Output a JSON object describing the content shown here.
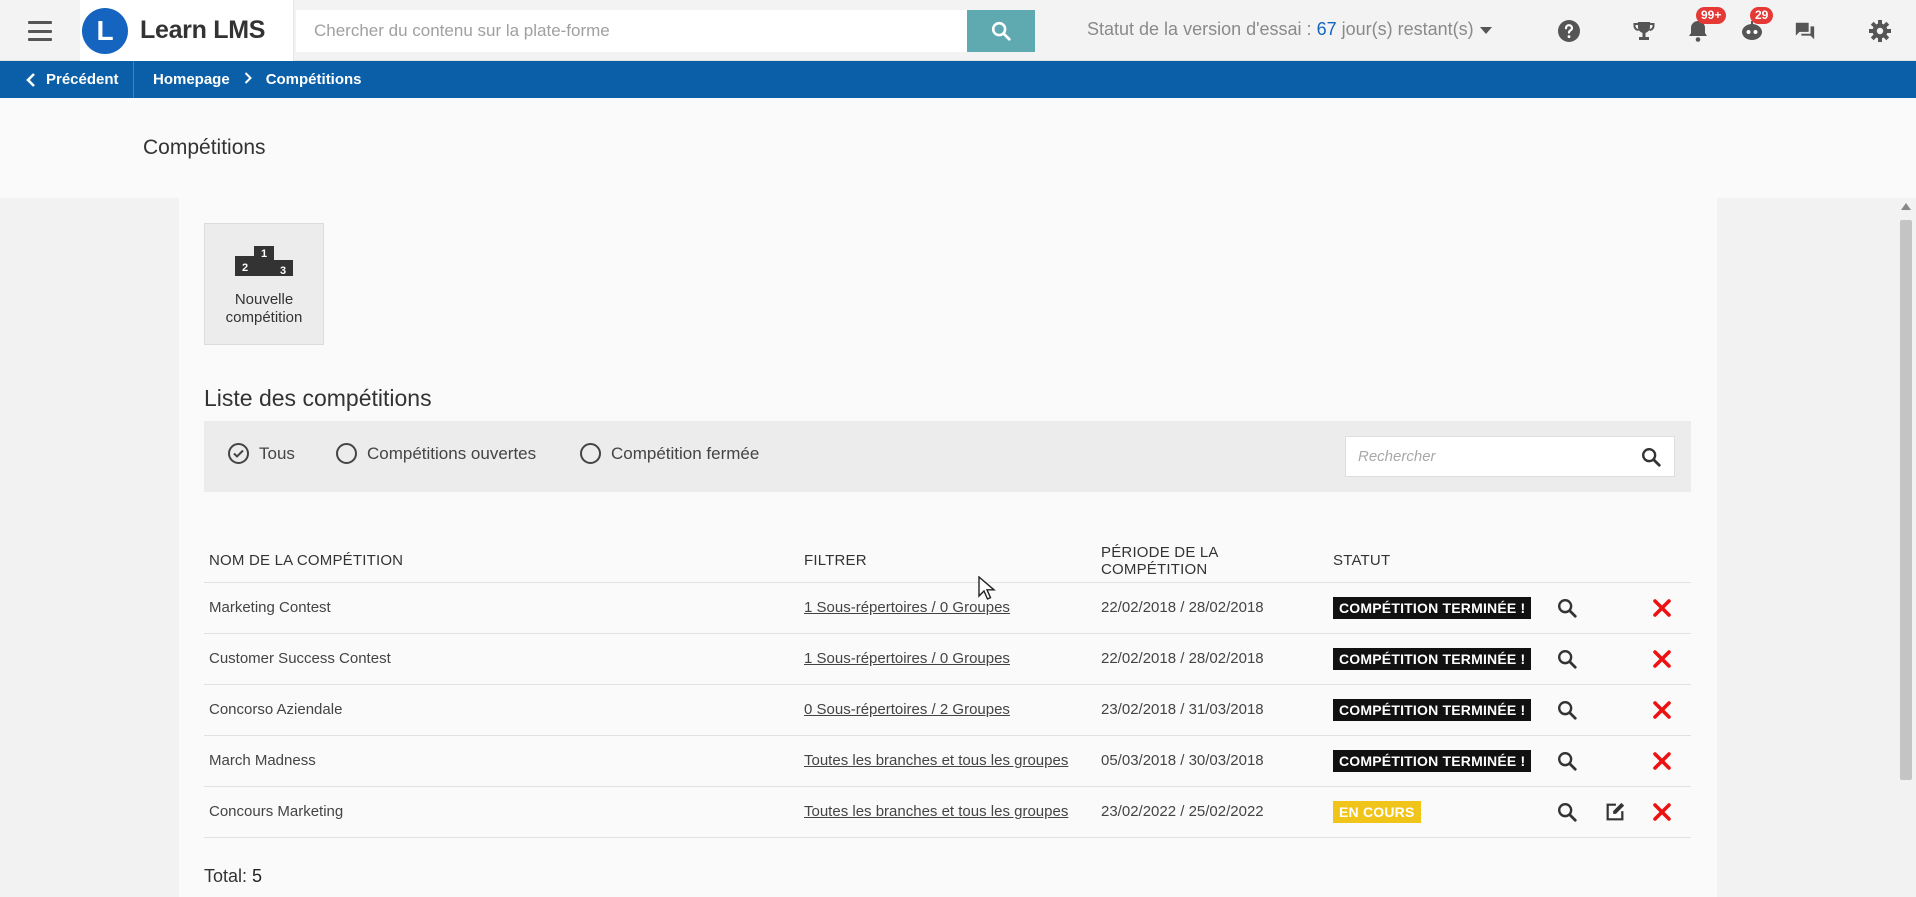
{
  "app": {
    "logo_letter": "L",
    "name": "Learn LMS"
  },
  "topbar": {
    "search_placeholder": "Chercher du contenu sur la plate-forme",
    "trial_prefix": "Statut de la version d'essai : ",
    "trial_days": "67",
    "trial_suffix": " jour(s) restant(s)",
    "notifications_badge": "99+",
    "messages_badge": "29"
  },
  "breadcrumb": {
    "back_label": "Précédent",
    "home": "Homepage",
    "current": "Compétitions"
  },
  "page": {
    "title": "Compétitions"
  },
  "new_competition": {
    "label_line1": "Nouvelle",
    "label_line2": "compétition",
    "podium": [
      "2",
      "1",
      "3"
    ]
  },
  "list": {
    "title": "Liste des compétitions",
    "filters": [
      "Tous",
      "Compétitions ouvertes",
      "Compétition fermée"
    ],
    "selected_filter": "Tous",
    "search_placeholder": "Rechercher",
    "columns": [
      "NOM DE LA COMPÉTITION",
      "FILTRER",
      "PÉRIODE DE LA COMPÉTITION",
      "STATUT"
    ],
    "rows": [
      {
        "name": "Marketing Contest",
        "filter": "1 Sous-répertoires / 0 Groupes",
        "period": "22/02/2018 / 28/02/2018",
        "status": "COMPÉTITION TERMINÉE !"
      },
      {
        "name": "Customer Success Contest",
        "filter": "1 Sous-répertoires / 0 Groupes",
        "period": "22/02/2018 / 28/02/2018",
        "status": "COMPÉTITION TERMINÉE !"
      },
      {
        "name": "Concorso Aziendale",
        "filter": "0 Sous-répertoires / 2 Groupes",
        "period": "23/02/2018 / 31/03/2018",
        "status": "COMPÉTITION TERMINÉE !"
      },
      {
        "name": "March Madness",
        "filter": "Toutes les branches et tous les groupes",
        "period": "05/03/2018 / 30/03/2018",
        "status": "COMPÉTITION TERMINÉE !"
      },
      {
        "name": "Concours Marketing",
        "filter": "Toutes les branches et tous les groupes",
        "period": "23/02/2022 / 25/02/2022",
        "status": "EN COURS"
      }
    ],
    "total_label": "Total: ",
    "total_value": "5"
  },
  "colors": {
    "brand": "#1565c0",
    "breadcrumb_bar": "#0a5fa8",
    "search_button": "#5fa9b0",
    "status_done": "#111111",
    "status_running": "#f0c419",
    "delete": "#e11"
  }
}
